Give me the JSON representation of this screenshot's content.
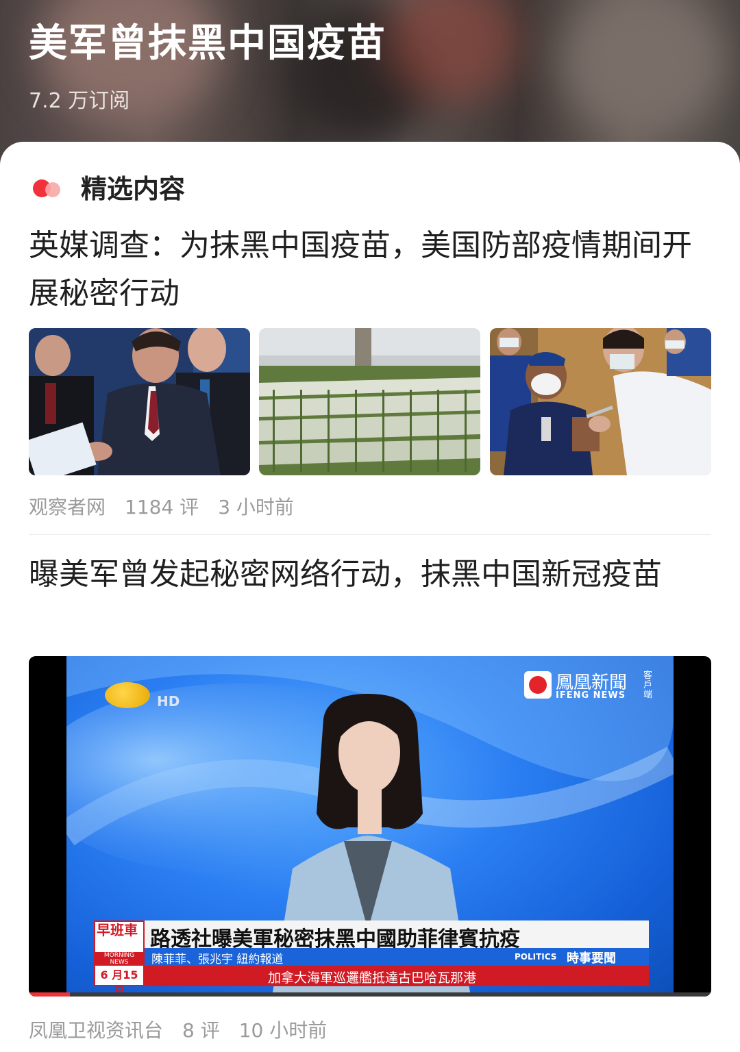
{
  "header": {
    "title": "美军曾抹黑中国疫苗",
    "subscribers": "7.2 万订阅"
  },
  "section": {
    "title": "精选内容"
  },
  "articles": [
    {
      "title": "英媒调查：为抹黑中国疫苗，美国防部疫情期间开展秘密行动",
      "source": "观察者网",
      "comments": "1184 评",
      "time": "3 小时前"
    },
    {
      "title": "曝美军曾发起秘密网络行动，抹黑中国新冠疫苗",
      "source": "凤凰卫视资讯台",
      "comments": "8 评",
      "time": "10 小时前"
    }
  ],
  "video": {
    "logo_hd": "HD",
    "brand": "鳳凰新聞",
    "brand_sub": "IFENG NEWS",
    "brand_side": "客戶端",
    "program": "早班車",
    "program_en": "MORNING NEWS",
    "date": "6 月15日",
    "headline": "路透社曝美軍秘密抹黑中國助菲律賓抗疫",
    "reporters": "陳菲菲、張兆宇  紐約報道",
    "category_en": "POLITICS",
    "category": "時事要聞",
    "ticker": "加拿大海軍巡邏艦抵達古巴哈瓦那港",
    "progress": 0.06
  },
  "colors": {
    "accent": "#f0333a",
    "video_red": "#d01a24",
    "video_blue": "#1a63d9"
  }
}
